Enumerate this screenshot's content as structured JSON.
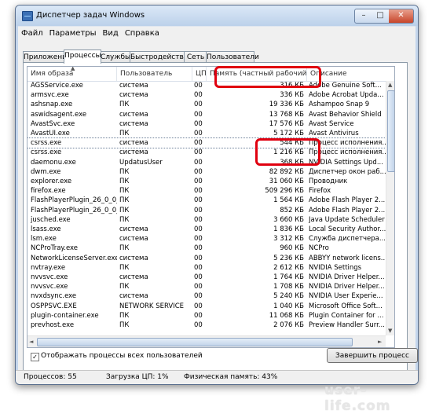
{
  "window": {
    "title": "Диспетчер задач Windows"
  },
  "menu": [
    "Файл",
    "Параметры",
    "Вид",
    "Справка"
  ],
  "tabs": [
    "Приложения",
    "Процессы",
    "Службы",
    "Быстродействие",
    "Сеть",
    "Пользователи"
  ],
  "active_tab": "Процессы",
  "columns": [
    "Имя образа",
    "Пользователь",
    "ЦП",
    "Память (частный рабочий набор)",
    "Описание"
  ],
  "processes": [
    [
      "AGSService.exe",
      "система",
      "00",
      "316 КБ",
      "Adobe Genuine Soft..."
    ],
    [
      "armsvc.exe",
      "система",
      "00",
      "336 КБ",
      "Adobe Acrobat Upda..."
    ],
    [
      "ashsnap.exe",
      "ПК",
      "00",
      "19 336 КБ",
      "Ashampoo Snap 9"
    ],
    [
      "aswidsagent.exe",
      "система",
      "00",
      "13 768 КБ",
      "Avast Behavior Shield"
    ],
    [
      "AvastSvc.exe",
      "система",
      "00",
      "17 576 КБ",
      "Avast Service"
    ],
    [
      "AvastUI.exe",
      "ПК",
      "00",
      "5 172 КБ",
      "Avast Antivirus"
    ],
    [
      "csrss.exe",
      "система",
      "00",
      "544 КБ",
      "Процесс исполнения..."
    ],
    [
      "csrss.exe",
      "система",
      "00",
      "1 216 КБ",
      "Процесс исполнения..."
    ],
    [
      "daemonu.exe",
      "UpdatusUser",
      "00",
      "368 КБ",
      "NVIDIA Settings Upd..."
    ],
    [
      "dwm.exe",
      "ПК",
      "00",
      "82 892 КБ",
      "Диспетчер окон раб..."
    ],
    [
      "explorer.exe",
      "ПК",
      "00",
      "31 060 КБ",
      "Проводник"
    ],
    [
      "firefox.exe",
      "ПК",
      "00",
      "509 296 КБ",
      "Firefox"
    ],
    [
      "FlashPlayerPlugin_26_0_0_1...",
      "ПК",
      "00",
      "1 564 КБ",
      "Adobe Flash Player 2..."
    ],
    [
      "FlashPlayerPlugin_26_0_0_1...",
      "ПК",
      "00",
      "852 КБ",
      "Adobe Flash Player 2..."
    ],
    [
      "jusched.exe",
      "ПК",
      "00",
      "3 660 КБ",
      "Java Update Scheduler"
    ],
    [
      "lsass.exe",
      "система",
      "00",
      "1 836 КБ",
      "Local Security Author..."
    ],
    [
      "lsm.exe",
      "система",
      "00",
      "3 312 КБ",
      "Служба диспетчера..."
    ],
    [
      "NCProTray.exe",
      "ПК",
      "00",
      "960 КБ",
      "NCPro"
    ],
    [
      "NetworkLicenseServer.exe",
      "система",
      "00",
      "5 236 КБ",
      "ABBYY network licens..."
    ],
    [
      "nvtray.exe",
      "ПК",
      "00",
      "2 612 КБ",
      "NVIDIA Settings"
    ],
    [
      "nvvsvc.exe",
      "система",
      "00",
      "1 764 КБ",
      "NVIDIA Driver Helper..."
    ],
    [
      "nvvsvc.exe",
      "ПК",
      "00",
      "1 708 КБ",
      "NVIDIA Driver Helper..."
    ],
    [
      "nvxdsync.exe",
      "система",
      "00",
      "5 240 КБ",
      "NVIDIA User Experie..."
    ],
    [
      "OSPPSVC.EXE",
      "NETWORK SERVICE",
      "00",
      "1 040 КБ",
      "Microsoft Office Soft..."
    ],
    [
      "plugin-container.exe",
      "ПК",
      "00",
      "11 068 КБ",
      "Plugin Container for ..."
    ],
    [
      "prevhost.exe",
      "ПК",
      "00",
      "2 076 КБ",
      "Preview Handler Surr..."
    ]
  ],
  "selected_row": 6,
  "show_all_label": "Отображать процессы всех пользователей",
  "show_all_checked": true,
  "end_process_label": "Завершить процесс",
  "status": {
    "processes": "Процессов: 55",
    "cpu": "Загрузка ЦП: 1%",
    "memory": "Физическая память: 43%"
  },
  "watermark": "user-life.com",
  "highlight_color": "#e0000f"
}
